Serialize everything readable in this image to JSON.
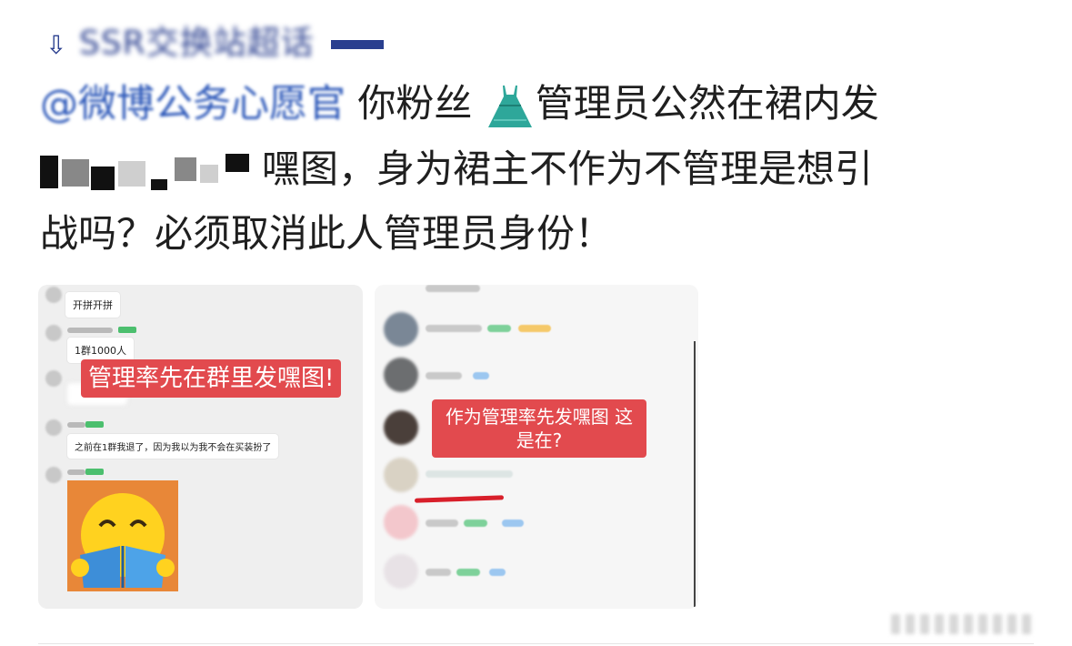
{
  "post": {
    "topic": {
      "prefix_icon": "down-arrow-icon",
      "text": "SSR交换站超话"
    },
    "mention": "@微博公务心愿官",
    "text_line1_rest": " 你粉丝",
    "dress_icon": "dress-emoji-icon",
    "text_line1_tail": "管理员公然在裙内发",
    "text_line2_rest": "嘿图，身为裙主不作为不管理是想引",
    "text_line3": "战吗？必须取消此人管理员身份！"
  },
  "left_image": {
    "chat_messages": [
      "开拼开拼",
      "1群1000人",
      "之前在1群我退了，因为我以为我不会在买装扮了"
    ],
    "highlight_label": "管理率先在群里发嘿图!",
    "sticker_icon": "reading-smiley-sticker-icon"
  },
  "right_image": {
    "highlight_label": "作为管理率先发嘿图 这是在?"
  },
  "colors": {
    "highlight_red": "#e24a4e",
    "underline_red": "#d81f2a",
    "topic_blue": "#2a3f8f",
    "badge_green": "#4cbf6e",
    "sticker_orange": "#e88738"
  }
}
